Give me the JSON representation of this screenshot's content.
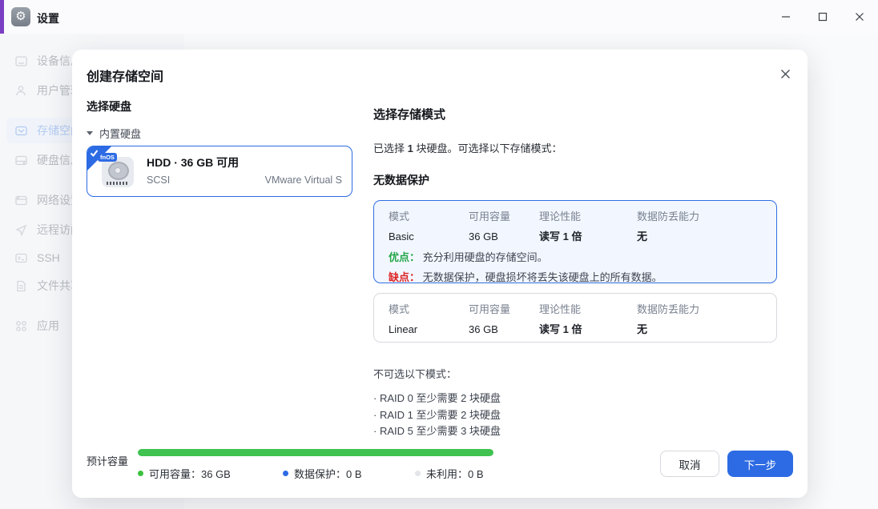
{
  "titlebar": {
    "app_title": "设置",
    "window_controls": [
      "minimize",
      "maximize",
      "close"
    ]
  },
  "sidebar": {
    "items": [
      {
        "label": "设备信息",
        "selected": false
      },
      {
        "label": "用户管理",
        "selected": false
      },
      {
        "label": "存储空间",
        "selected": true
      },
      {
        "label": "硬盘信息",
        "selected": false
      },
      {
        "label": "网络设置",
        "selected": false
      },
      {
        "label": "远程访问",
        "selected": false
      },
      {
        "label": "SSH",
        "selected": false
      },
      {
        "label": "文件共享",
        "selected": false
      },
      {
        "label": "应用",
        "selected": false
      }
    ]
  },
  "modal": {
    "title": "创建存储空间",
    "disk_section": {
      "title": "选择硬盘",
      "group_label": "内置硬盘",
      "disk": {
        "badge": "fnOS",
        "title": "HDD · 36 GB 可用",
        "interface": "SCSI",
        "model": "VMware Virtual S",
        "selected": true
      }
    },
    "mode_section": {
      "title": "选择存储模式",
      "summary_prefix": "已选择 ",
      "summary_count": "1",
      "summary_suffix": " 块硬盘。可选择以下存储模式：",
      "group_title": "无数据保护",
      "table_headers": [
        "模式",
        "可用容量",
        "理论性能",
        "数据防丢能力"
      ],
      "modes": [
        {
          "name": "Basic",
          "capacity": "36 GB",
          "performance": "读写 1 倍",
          "protection": "无",
          "selected": true,
          "pros_label": "优点：",
          "pros_text": "充分利用硬盘的存储空间。",
          "cons_label": "缺点：",
          "cons_text": "无数据保护，硬盘损坏将丢失该硬盘上的所有数据。"
        },
        {
          "name": "Linear",
          "capacity": "36 GB",
          "performance": "读写 1 倍",
          "protection": "无",
          "selected": false
        }
      ],
      "unavailable_title": "不可选以下模式：",
      "unavailable_modes": [
        "· RAID 0  至少需要 2 块硬盘",
        "· RAID 1  至少需要 2 块硬盘",
        "· RAID 5  至少需要 3 块硬盘"
      ]
    },
    "footer": {
      "estimate_label": "预计容量",
      "available_percent": 100,
      "legend": [
        {
          "label": "可用容量：36 GB",
          "color": "#3cc13f"
        },
        {
          "label": "数据保护：0 B",
          "color": "#2e6be5"
        },
        {
          "label": "未利用：0 B",
          "color": "#e3e5e9"
        }
      ],
      "cancel_label": "取消",
      "next_label": "下一步"
    }
  },
  "colors": {
    "accent_blue": "#2c6be3",
    "selected_card_bg": "#f2f7ff",
    "success_green": "#23a546",
    "danger_red": "#dd2222",
    "bar_green": "#3fc24f",
    "titlebar_strip_purple": "#7b3fc4"
  }
}
